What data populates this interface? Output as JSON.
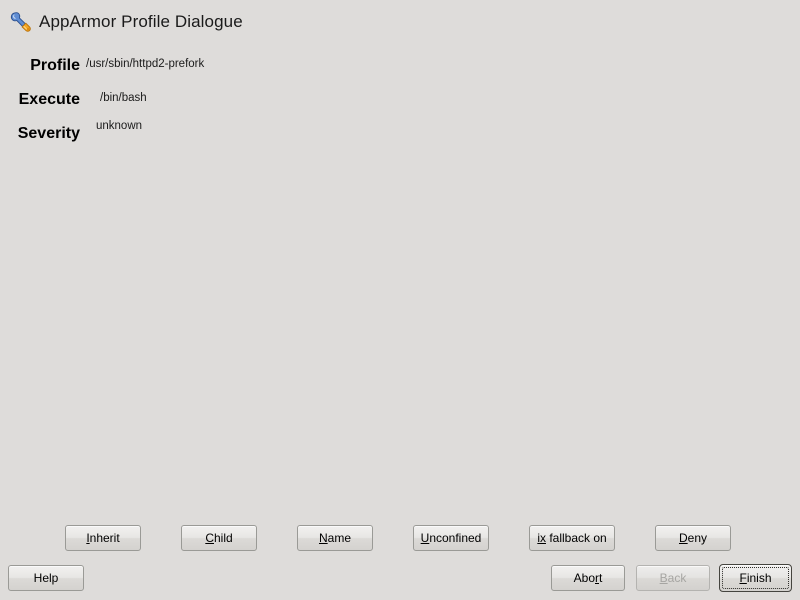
{
  "window": {
    "title": "AppArmor Profile Dialogue",
    "icon": "wrench-screwdriver-icon",
    "background_color": "#dedcda"
  },
  "fields": [
    {
      "label": "Profile",
      "value": "/usr/sbin/httpd2-prefork"
    },
    {
      "label": "Execute",
      "value": "/bin/bash"
    },
    {
      "label": "Severity",
      "value": "unknown"
    }
  ],
  "action_buttons": [
    {
      "label": "Inherit",
      "accel_before": "",
      "accel": "I",
      "accel_after": "nherit"
    },
    {
      "label": "Child",
      "accel_before": "",
      "accel": "C",
      "accel_after": "hild"
    },
    {
      "label": "Name",
      "accel_before": "",
      "accel": "N",
      "accel_after": "ame"
    },
    {
      "label": "Unconfined",
      "accel_before": "",
      "accel": "U",
      "accel_after": "nconfined"
    },
    {
      "label": "ix fallback on",
      "accel_before": "",
      "accel": "ix",
      "accel_after": " fallback on"
    },
    {
      "label": "Deny",
      "accel_before": "",
      "accel": "D",
      "accel_after": "eny"
    }
  ],
  "nav_buttons": {
    "help": {
      "label": "Help",
      "accel_before": "Help",
      "accel": "",
      "accel_after": "",
      "enabled": true,
      "default": false
    },
    "abort": {
      "label": "Abort",
      "accel_before": "Abo",
      "accel": "r",
      "accel_after": "t",
      "enabled": true,
      "default": false
    },
    "back": {
      "label": "Back",
      "accel_before": "",
      "accel": "B",
      "accel_after": "ack",
      "enabled": false,
      "default": false
    },
    "finish": {
      "label": "Finish",
      "accel_before": "",
      "accel": "F",
      "accel_after": "inish",
      "enabled": true,
      "default": true
    }
  }
}
